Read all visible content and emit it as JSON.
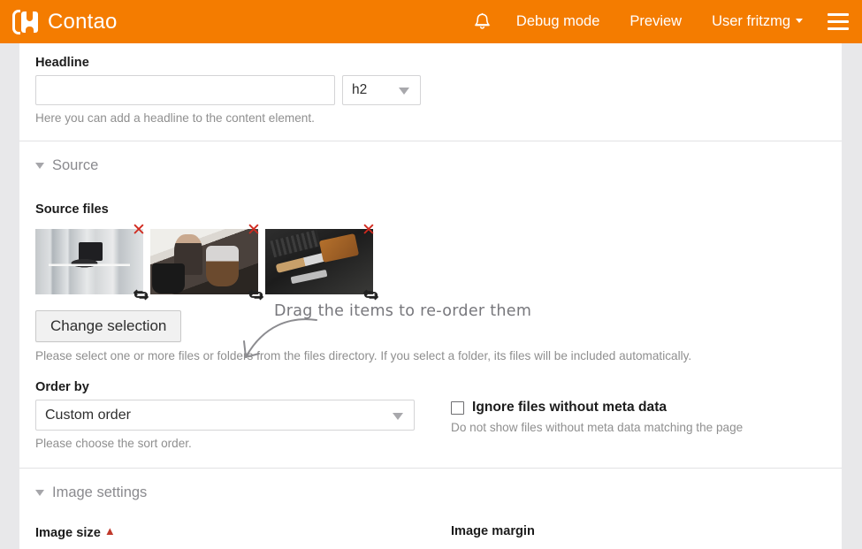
{
  "topbar": {
    "brand": "Contao",
    "bell_icon": "bell-icon",
    "debug_label": "Debug mode",
    "preview_label": "Preview",
    "user_label": "User fritzmg",
    "menu_icon": "hamburger-menu-icon",
    "accent_color": "#f47c00"
  },
  "headline": {
    "label": "Headline",
    "value": "",
    "placeholder": "",
    "type_value": "h2",
    "hint": "Here you can add a headline to the content element."
  },
  "source": {
    "legend": "Source",
    "files_label": "Source files",
    "annotation": "Drag the items to re-order them",
    "thumbnails": [
      {
        "alt": "bright-office-desk-window",
        "delete_icon": "close-icon",
        "swap_icon": "swap-icon"
      },
      {
        "alt": "person-with-coffee-pourover",
        "delete_icon": "close-icon",
        "swap_icon": "swap-icon"
      },
      {
        "alt": "dark-flatlay-tools",
        "delete_icon": "close-icon",
        "swap_icon": "swap-icon"
      }
    ],
    "change_selection_label": "Change selection",
    "files_hint": "Please select one or more files or folders from the files directory. If you select a folder, its files will be included automatically.",
    "order_label": "Order by",
    "order_value": "Custom order",
    "order_hint": "Please choose the sort order.",
    "ignore_label": "Ignore files without meta data",
    "ignore_hint": "Do not show files without meta data matching the page",
    "ignore_checked": false
  },
  "image_settings": {
    "legend": "Image settings",
    "size_label": "Image size",
    "size_required": "▲",
    "margin_label": "Image margin"
  }
}
